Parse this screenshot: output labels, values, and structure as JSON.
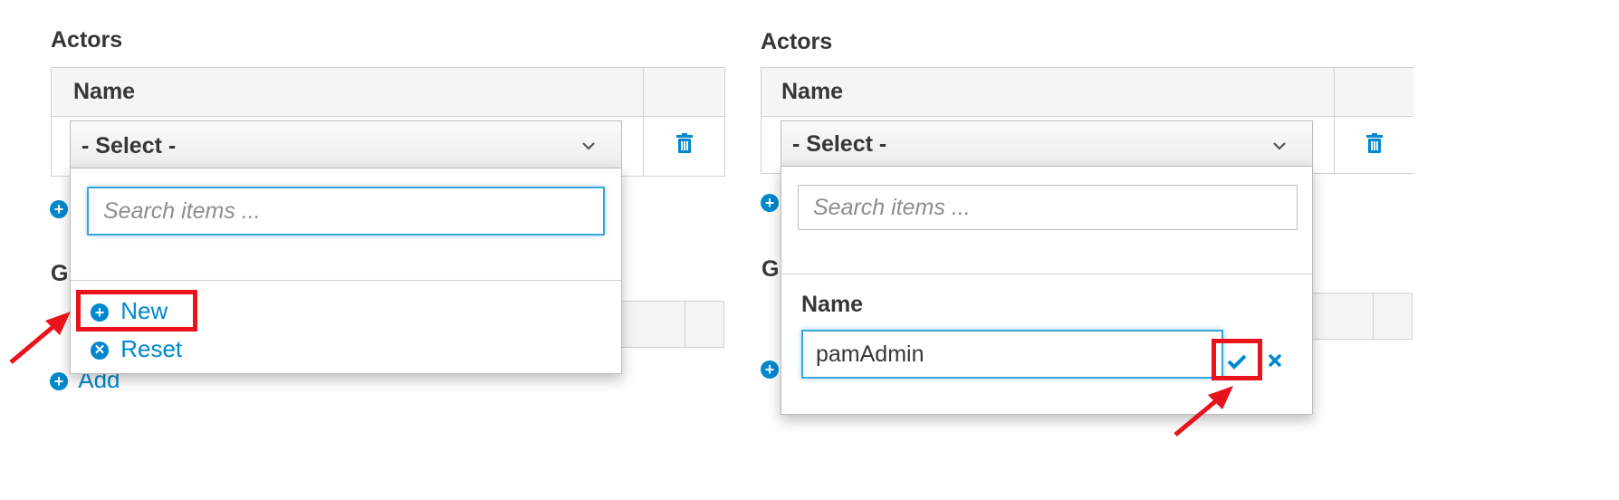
{
  "left": {
    "actors_title": "Actors",
    "col_name": "Name",
    "select_value": "- Select -",
    "search_placeholder": "Search items ...",
    "groups_partial": "Gr",
    "new_label": "New",
    "reset_label": "Reset",
    "add_label": "Add"
  },
  "right": {
    "actors_title": "Actors",
    "col_name": "Name",
    "select_value": "- Select -",
    "search_placeholder": "Search items ...",
    "groups_partial": "Gr",
    "new_name_label": "Name",
    "new_name_value": "pamAdmin"
  },
  "colors": {
    "accent": "#0088ce",
    "highlight": "#e8131b",
    "focus": "#39a5dc"
  },
  "icons": [
    "trash-icon",
    "chevron-down-icon",
    "plus-circle-icon",
    "times-circle-icon",
    "check-icon",
    "close-icon",
    "arrow-icon"
  ]
}
